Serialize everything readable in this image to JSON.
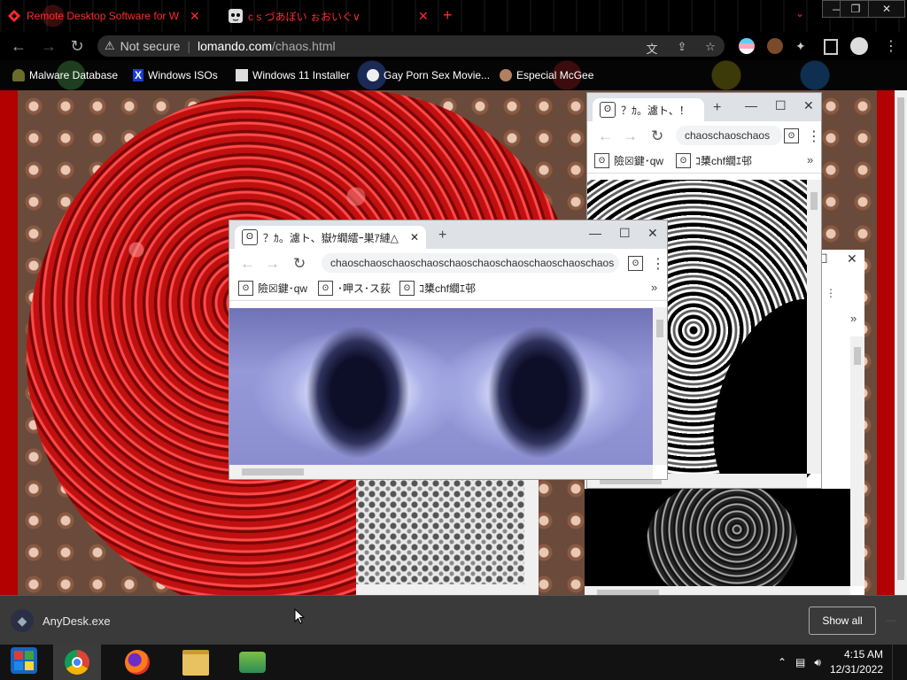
{
  "browser": {
    "tabs": [
      {
        "title": "Remote Desktop Software for W",
        "active": true
      },
      {
        "title": "c s づあぼい ぉおいぐ∨",
        "active": false
      }
    ],
    "omnibox": {
      "security_label": "Not secure",
      "host": "lomando.com",
      "path": "/chaos.html"
    },
    "bookmarks": [
      {
        "label": "Malware Database"
      },
      {
        "label": "Windows ISOs"
      },
      {
        "label": "Windows 11 Installer"
      },
      {
        "label": "Gay Porn Sex Movie..."
      },
      {
        "label": "Especial McGee"
      }
    ]
  },
  "popups": {
    "front": {
      "tab_title": "？ｶ。濾ト、嶽ｹ繝繧ｰ巣ｱ縺△",
      "url": "chaoschaoschaoschaoschaoschaoschaoschaoschaoschaos",
      "bookmarks": [
        "險☒鍵･qw",
        "･呷ス･ス荻",
        "ｺ橥chf繝ｴ邨"
      ]
    },
    "back": {
      "tab_title": "？ｶ。濾ト、！",
      "url": "chaoschaoschaos",
      "bookmarks": [
        "險☒鍵･qw",
        "ｺ橥chf繝ｴ邨"
      ]
    }
  },
  "download_shelf": {
    "item_name": "AnyDesk.exe",
    "show_all_label": "Show all"
  },
  "taskbar": {
    "time": "4:15 AM",
    "date": "12/31/2022"
  },
  "colors": {
    "tab_text": "#ff2a2a",
    "page_red": "#b30000",
    "shelf_bg": "#3a3a3a"
  }
}
